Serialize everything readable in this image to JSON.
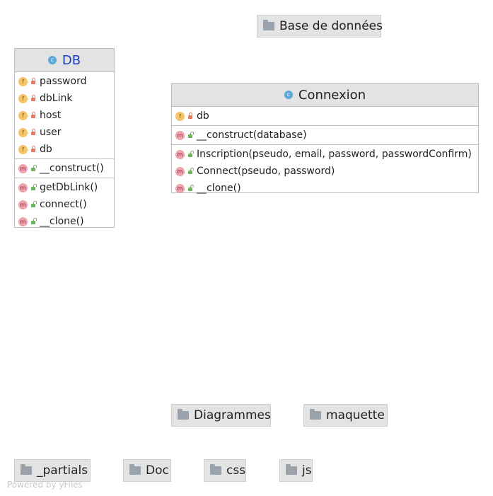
{
  "packages": {
    "base": "Base de données",
    "diagrammes": "Diagrammes",
    "maquette": "maquette",
    "partials": "_partials",
    "doc": "Doc",
    "css": "css",
    "js": "js"
  },
  "class_db": {
    "name": "DB",
    "kind_badge": "c",
    "fields": [
      "password",
      "dbLink",
      "host",
      "user",
      "db"
    ],
    "constructors": [
      "__construct()"
    ],
    "methods": [
      "getDbLink()",
      "connect()",
      "__clone()"
    ]
  },
  "class_connexion": {
    "name": "Connexion",
    "kind_badge": "c",
    "fields": [
      "db"
    ],
    "constructors": [
      "__construct(database)"
    ],
    "methods": [
      "Inscription(pseudo, email, password, passwordConfirm)",
      "Connect(pseudo, password)",
      "__clone()"
    ]
  },
  "badges": {
    "field": "f",
    "method": "m"
  },
  "footer": "Powered by yFiles",
  "colors": {
    "node_header": "#e3e3e3",
    "class_badge": "#59a9d6",
    "field_badge": "#f3c46b",
    "method_badge": "#eea3ad",
    "private_lock": "#e67a5a",
    "public_lock": "#6cb358",
    "db_title": "#1a3cc0"
  }
}
